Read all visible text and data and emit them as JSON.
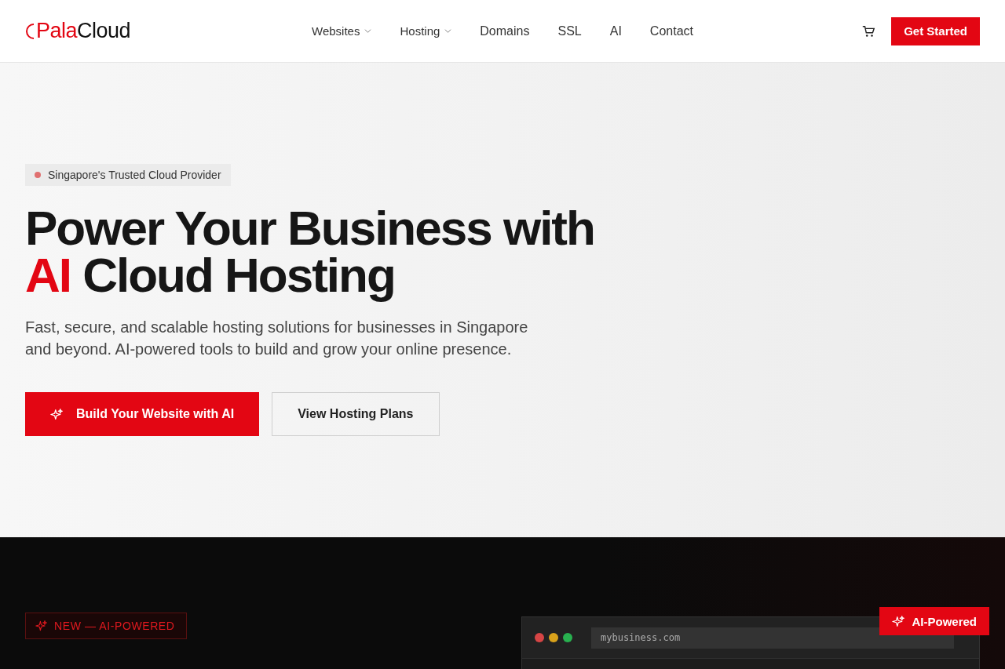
{
  "header": {
    "logo": {
      "accent": "Pala",
      "rest": "Cloud"
    },
    "nav": [
      {
        "label": "Websites",
        "kind": "dropdown"
      },
      {
        "label": "Hosting",
        "kind": "dropdown"
      },
      {
        "label": "Domains",
        "kind": "link"
      },
      {
        "label": "SSL",
        "kind": "link"
      },
      {
        "label": "AI",
        "kind": "link"
      },
      {
        "label": "Contact",
        "kind": "link"
      }
    ],
    "cta": "Get Started"
  },
  "hero": {
    "badge": "Singapore's Trusted Cloud Provider",
    "headline": {
      "line_1": "Power Your Business with",
      "accent": "AI",
      "rest": "Cloud Hosting"
    },
    "description": "Fast, secure, and scalable hosting solutions for businesses in Singapore and beyond. AI-powered tools to build and grow your online presence.",
    "buttons": [
      {
        "label": "Build Your Website with AI",
        "kind": "primary"
      },
      {
        "label": "View Hosting Plans",
        "kind": "secondary"
      }
    ]
  },
  "ai_section": {
    "badge": "NEW — AI-POWERED",
    "browser": {
      "url": "mybusiness.com"
    },
    "floating_badge": "AI-Powered"
  }
}
